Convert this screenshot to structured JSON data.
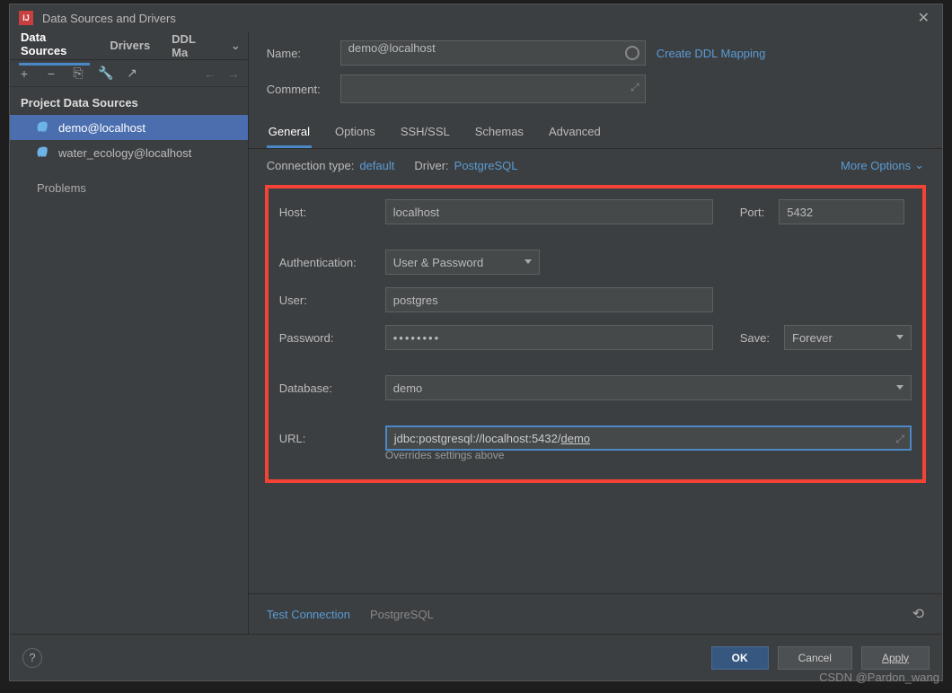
{
  "window": {
    "title": "Data Sources and Drivers"
  },
  "left": {
    "tabs": [
      "Data Sources",
      "Drivers",
      "DDL Ma"
    ],
    "section": "Project Data Sources",
    "items": [
      {
        "label": "demo@localhost"
      },
      {
        "label": "water_ecology@localhost"
      }
    ],
    "problems": "Problems"
  },
  "form_top": {
    "name_label": "Name:",
    "name_value": "demo@localhost",
    "comment_label": "Comment:",
    "ddl_link": "Create DDL Mapping"
  },
  "rtabs": [
    "General",
    "Options",
    "SSH/SSL",
    "Schemas",
    "Advanced"
  ],
  "conn": {
    "type_label": "Connection type:",
    "type_value": "default",
    "driver_label": "Driver:",
    "driver_value": "PostgreSQL",
    "more": "More Options"
  },
  "fields": {
    "host_label": "Host:",
    "host_value": "localhost",
    "port_label": "Port:",
    "port_value": "5432",
    "auth_label": "Authentication:",
    "auth_value": "User & Password",
    "user_label": "User:",
    "user_value": "postgres",
    "pwd_label": "Password:",
    "pwd_value": "••••••••",
    "save_label": "Save:",
    "save_value": "Forever",
    "db_label": "Database:",
    "db_value": "demo",
    "url_label": "URL:",
    "url_prefix": "jdbc:postgresql://localhost:5432/",
    "url_db": "demo",
    "url_hint": "Overrides settings above"
  },
  "test": {
    "label": "Test Connection",
    "driver": "PostgreSQL"
  },
  "buttons": {
    "ok": "OK",
    "cancel": "Cancel",
    "apply": "Apply"
  },
  "watermark": "CSDN @Pardon_wang"
}
